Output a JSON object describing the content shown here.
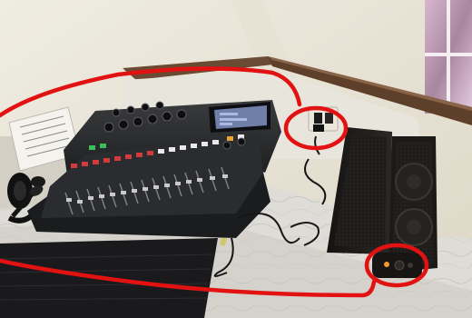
{
  "scene": {
    "subject": "audio-mixing-console-setup",
    "highlights": [
      {
        "name": "power-cable-outlet",
        "color": "#e31212"
      },
      {
        "name": "speaker-control-panel",
        "color": "#e31212"
      }
    ],
    "annotation_color": "#e31212",
    "mixer": {
      "screen_color": "#6f7fa8",
      "button_colors": [
        "#d23b3b",
        "#e9e9e9",
        "#39c05a",
        "#e7a431"
      ]
    },
    "speaker_color": "#1d1c1a",
    "counter_color": "#d8d6d1",
    "wall_color": "#eae6d8",
    "rail_color": "#6b4a33"
  }
}
